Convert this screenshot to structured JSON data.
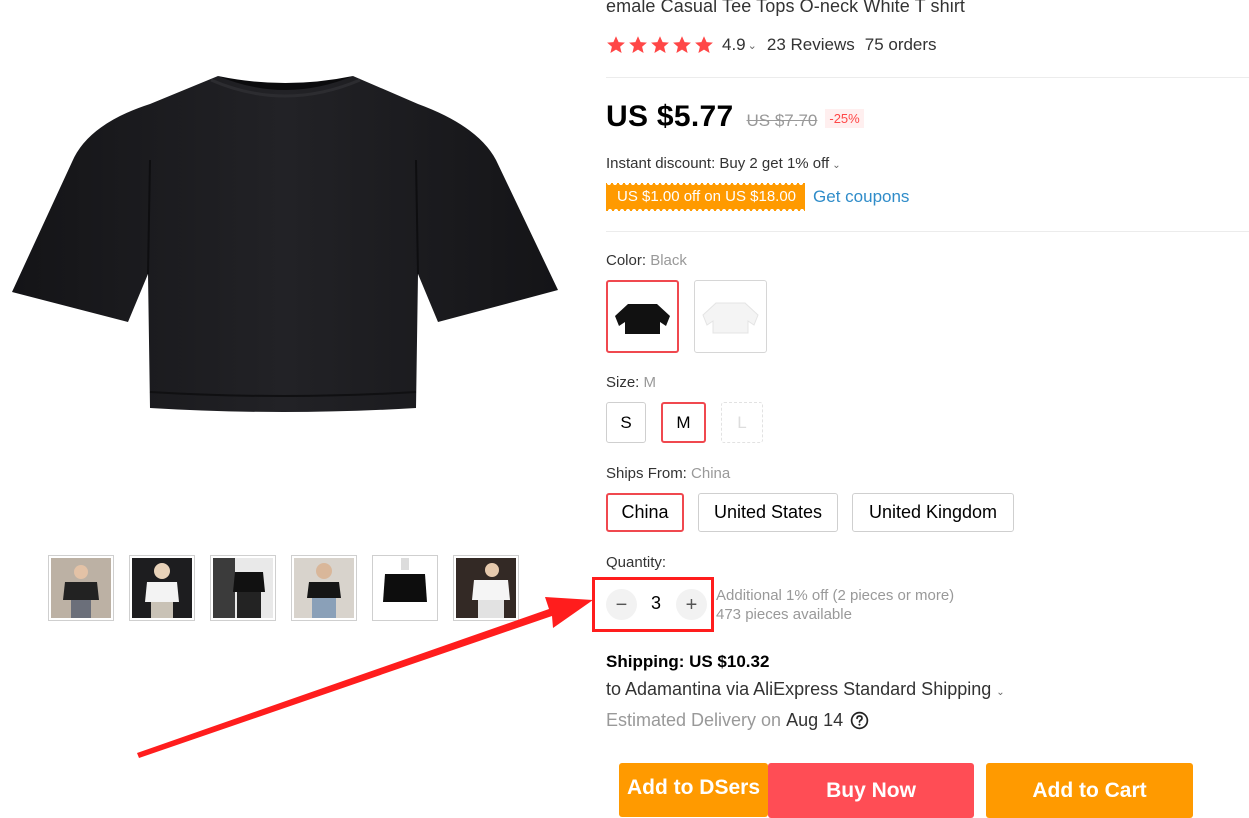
{
  "product": {
    "title": "emale Casual Tee Tops O-neck White T shirt",
    "rating": "4.9",
    "reviews": "23 Reviews",
    "orders": "75 orders"
  },
  "icons": {
    "star": "star-icon",
    "chevron": "chevron-down-icon",
    "help": "question-circle-icon",
    "minus": "minus-icon",
    "plus": "plus-icon"
  },
  "colors": {
    "accent_red": "#ff4d55",
    "accent_orange": "#ff9a00",
    "selected_border": "#f0484f",
    "link_blue": "#2f8cc9",
    "annotation_red": "#ff1d1d"
  },
  "price": {
    "current": "US $5.77",
    "original": "US $7.70",
    "discount": "-25%",
    "instant_discount": "Instant discount: Buy 2 get 1% off",
    "coupon": "US $1.00 off on US $18.00",
    "get_coupons": "Get coupons"
  },
  "color_option": {
    "label": "Color: ",
    "selected": "Black",
    "options": [
      "Black",
      "White"
    ]
  },
  "size_option": {
    "label": "Size: ",
    "selected": "M",
    "options": [
      "S",
      "M",
      "L"
    ]
  },
  "ships_from": {
    "label": "Ships From: ",
    "selected": "China",
    "options": [
      "China",
      "United States",
      "United Kingdom"
    ]
  },
  "quantity": {
    "label": "Quantity:",
    "minus": "−",
    "value": "3",
    "plus": "+",
    "note": "Additional 1% off (2 pieces or more)",
    "available": "473 pieces available"
  },
  "shipping": {
    "cost": "Shipping: US $10.32",
    "to": "to Adamantina via AliExpress Standard Shipping",
    "delivery_label": "Estimated Delivery on",
    "delivery_date": "Aug 14"
  },
  "actions": {
    "dsers": "Add to DSers",
    "buy": "Buy Now",
    "cart": "Add to Cart"
  }
}
